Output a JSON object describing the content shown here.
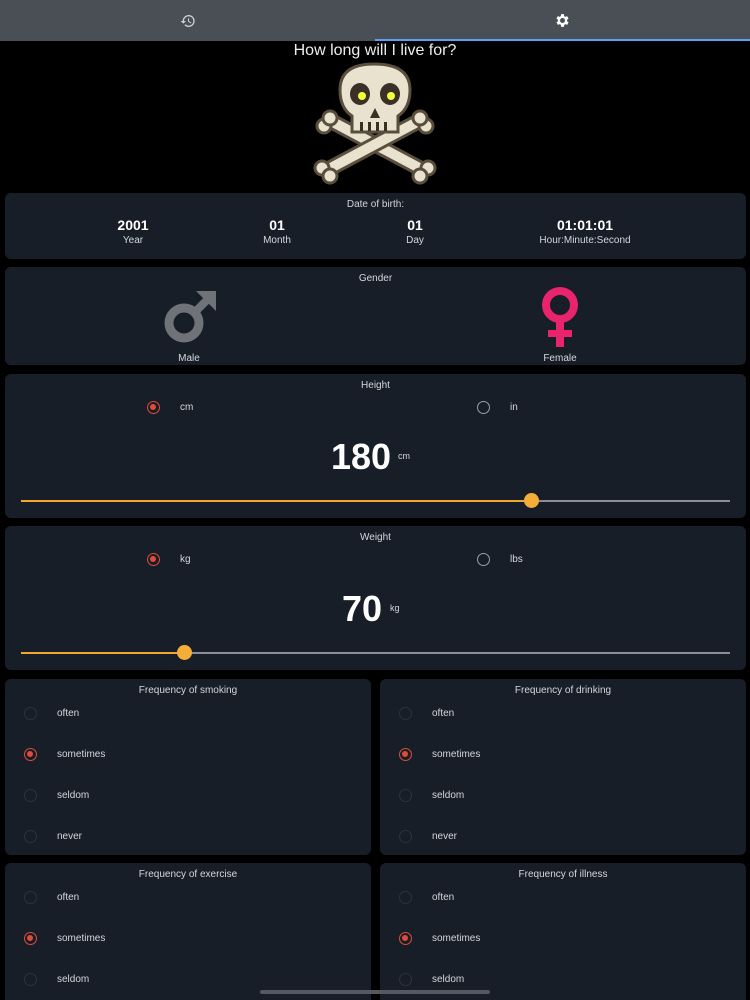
{
  "tabs": [
    {
      "name": "history-tab",
      "icon": "history-icon",
      "active": false
    },
    {
      "name": "settings-tab",
      "icon": "gear-icon",
      "active": true
    }
  ],
  "title": "How long will I live for?",
  "mascot_icon": "skull-crossbones-icon",
  "dob": {
    "title": "Date of birth:",
    "year": {
      "value": "2001",
      "label": "Year"
    },
    "month": {
      "value": "01",
      "label": "Month"
    },
    "day": {
      "value": "01",
      "label": "Day"
    },
    "time": {
      "value": "01:01:01",
      "label": "Hour:Minute:Second"
    }
  },
  "gender": {
    "title": "Gender",
    "male": {
      "label": "Male",
      "icon": "male-symbol-icon",
      "color": "#6f7276"
    },
    "female": {
      "label": "Female",
      "icon": "female-symbol-icon",
      "color": "#e8256c"
    }
  },
  "height": {
    "title": "Height",
    "units": [
      "cm",
      "in"
    ],
    "selected_unit": "cm",
    "value": "180",
    "unit_label": "cm",
    "slider_fraction": 0.72
  },
  "weight": {
    "title": "Weight",
    "units": [
      "kg",
      "lbs"
    ],
    "selected_unit": "kg",
    "value": "70",
    "unit_label": "kg",
    "slider_fraction": 0.23
  },
  "frequency_options": [
    "often",
    "sometimes",
    "seldom",
    "never"
  ],
  "smoking": {
    "title": "Frequency of smoking",
    "selected": "sometimes"
  },
  "drinking": {
    "title": "Frequency of drinking",
    "selected": "sometimes"
  },
  "exercise": {
    "title": "Frequency of exercise",
    "selected": "sometimes"
  },
  "illness": {
    "title": "Frequency of illness",
    "selected": "sometimes"
  },
  "colors": {
    "accent": "#e04b3a",
    "slider": "#f0a830",
    "card": "#181e27",
    "tab_indicator": "#5aa0ff"
  }
}
